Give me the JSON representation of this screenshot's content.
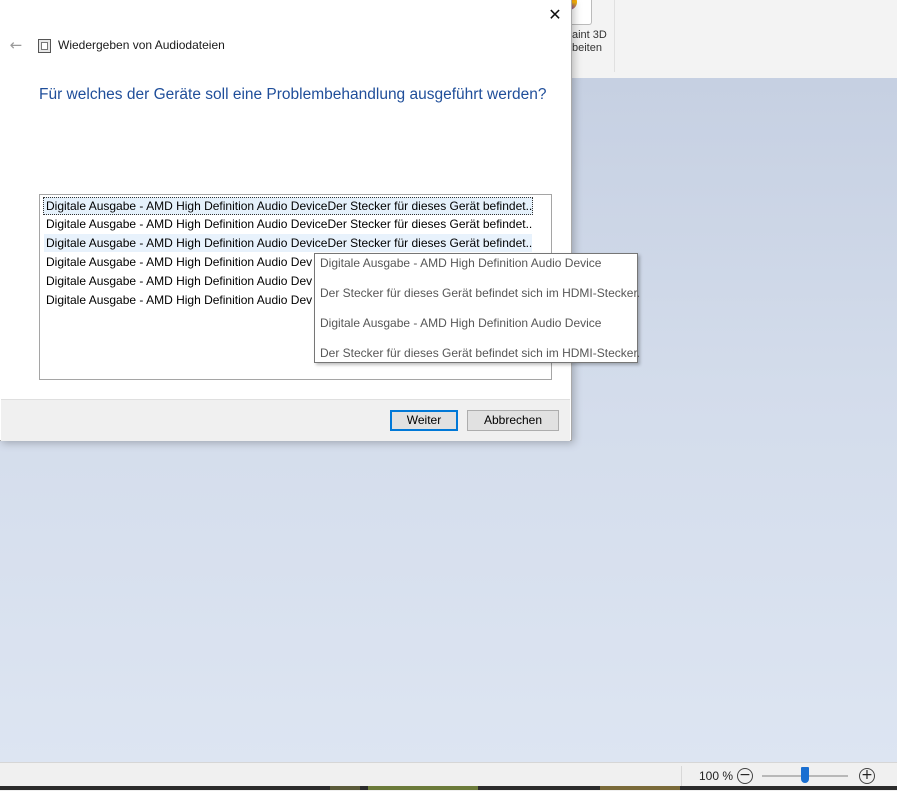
{
  "background_app": {
    "paint3d_label": "aint 3D\nbeiten",
    "zoom_label": "100 %",
    "zoom_out_icon": "minus-circle",
    "zoom_in_icon": "plus-circle",
    "zoom_level_fraction": 0.5
  },
  "dialog": {
    "title": "Wiedergeben von Audiodateien",
    "question": "Für welches der Geräte soll eine Problembehandlung ausgeführt werden?",
    "close_symbol": "✕",
    "back_symbol": "←",
    "items": [
      "Digitale Ausgabe - AMD High Definition Audio DeviceDer Stecker für dieses Gerät befindet...",
      "Digitale Ausgabe - AMD High Definition Audio DeviceDer Stecker für dieses Gerät befindet...",
      "Digitale Ausgabe - AMD High Definition Audio DeviceDer Stecker für dieses Gerät befindet...",
      "Digitale Ausgabe - AMD High Definition Audio Dev",
      "Digitale Ausgabe - AMD High Definition Audio Dev",
      "Digitale Ausgabe - AMD High Definition Audio Dev"
    ],
    "buttons": {
      "next": "Weiter",
      "cancel": "Abbrechen"
    }
  },
  "tooltip": {
    "lines": [
      "Digitale Ausgabe - AMD High Definition Audio Device",
      "Der Stecker für dieses Gerät befindet sich im HDMI-Stecker.",
      "Digitale Ausgabe - AMD High Definition Audio Device",
      "Der Stecker für dieses Gerät befindet sich im HDMI-Stecker."
    ]
  },
  "colors": {
    "accent": "#0078d7",
    "question_text": "#1f4e9a"
  }
}
